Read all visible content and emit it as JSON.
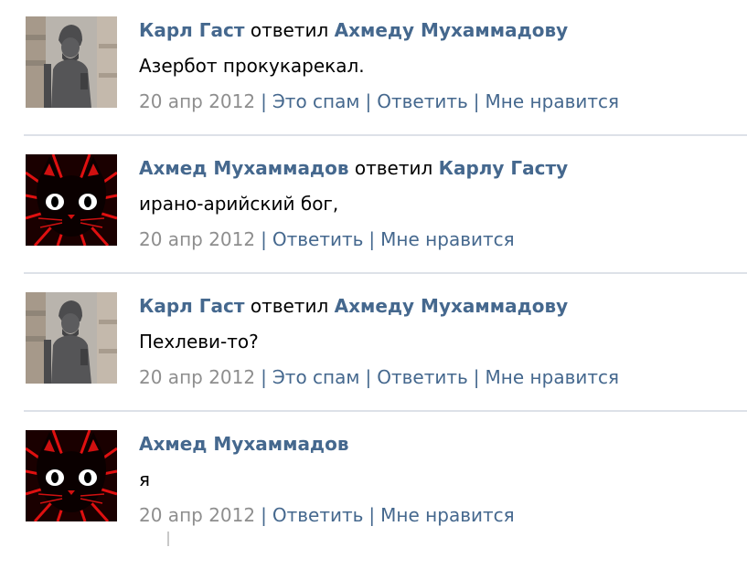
{
  "comments": [
    {
      "author": "Карл Гаст",
      "verb": "ответил",
      "target": "Ахмеду Мухаммадову",
      "text": "Азербот прокукарекал.",
      "date": "20 апр 2012",
      "actions": [
        "Это спам",
        "Ответить",
        "Мне нравится"
      ],
      "avatar": "soldier-statue-avatar"
    },
    {
      "author": "Ахмед Мухаммадов",
      "verb": "ответил",
      "target": "Карлу Гасту",
      "text": "ирано-арийский бог,",
      "date": "20 апр 2012",
      "actions": [
        "Ответить",
        "Мне нравится"
      ],
      "avatar": "red-cat-avatar"
    },
    {
      "author": "Карл Гаст",
      "verb": "ответил",
      "target": "Ахмеду Мухаммадову",
      "text": "Пехлеви-то?",
      "date": "20 апр 2012",
      "actions": [
        "Это спам",
        "Ответить",
        "Мне нравится"
      ],
      "avatar": "soldier-statue-avatar"
    },
    {
      "author": "Ахмед Мухаммадов",
      "text": "я",
      "date": "20 апр 2012",
      "actions": [
        "Ответить",
        "Мне нравится"
      ],
      "avatar": "red-cat-avatar"
    }
  ],
  "colors": {
    "link": "#45688e",
    "date": "#8e8e8e",
    "divider": "#dde1e8"
  }
}
